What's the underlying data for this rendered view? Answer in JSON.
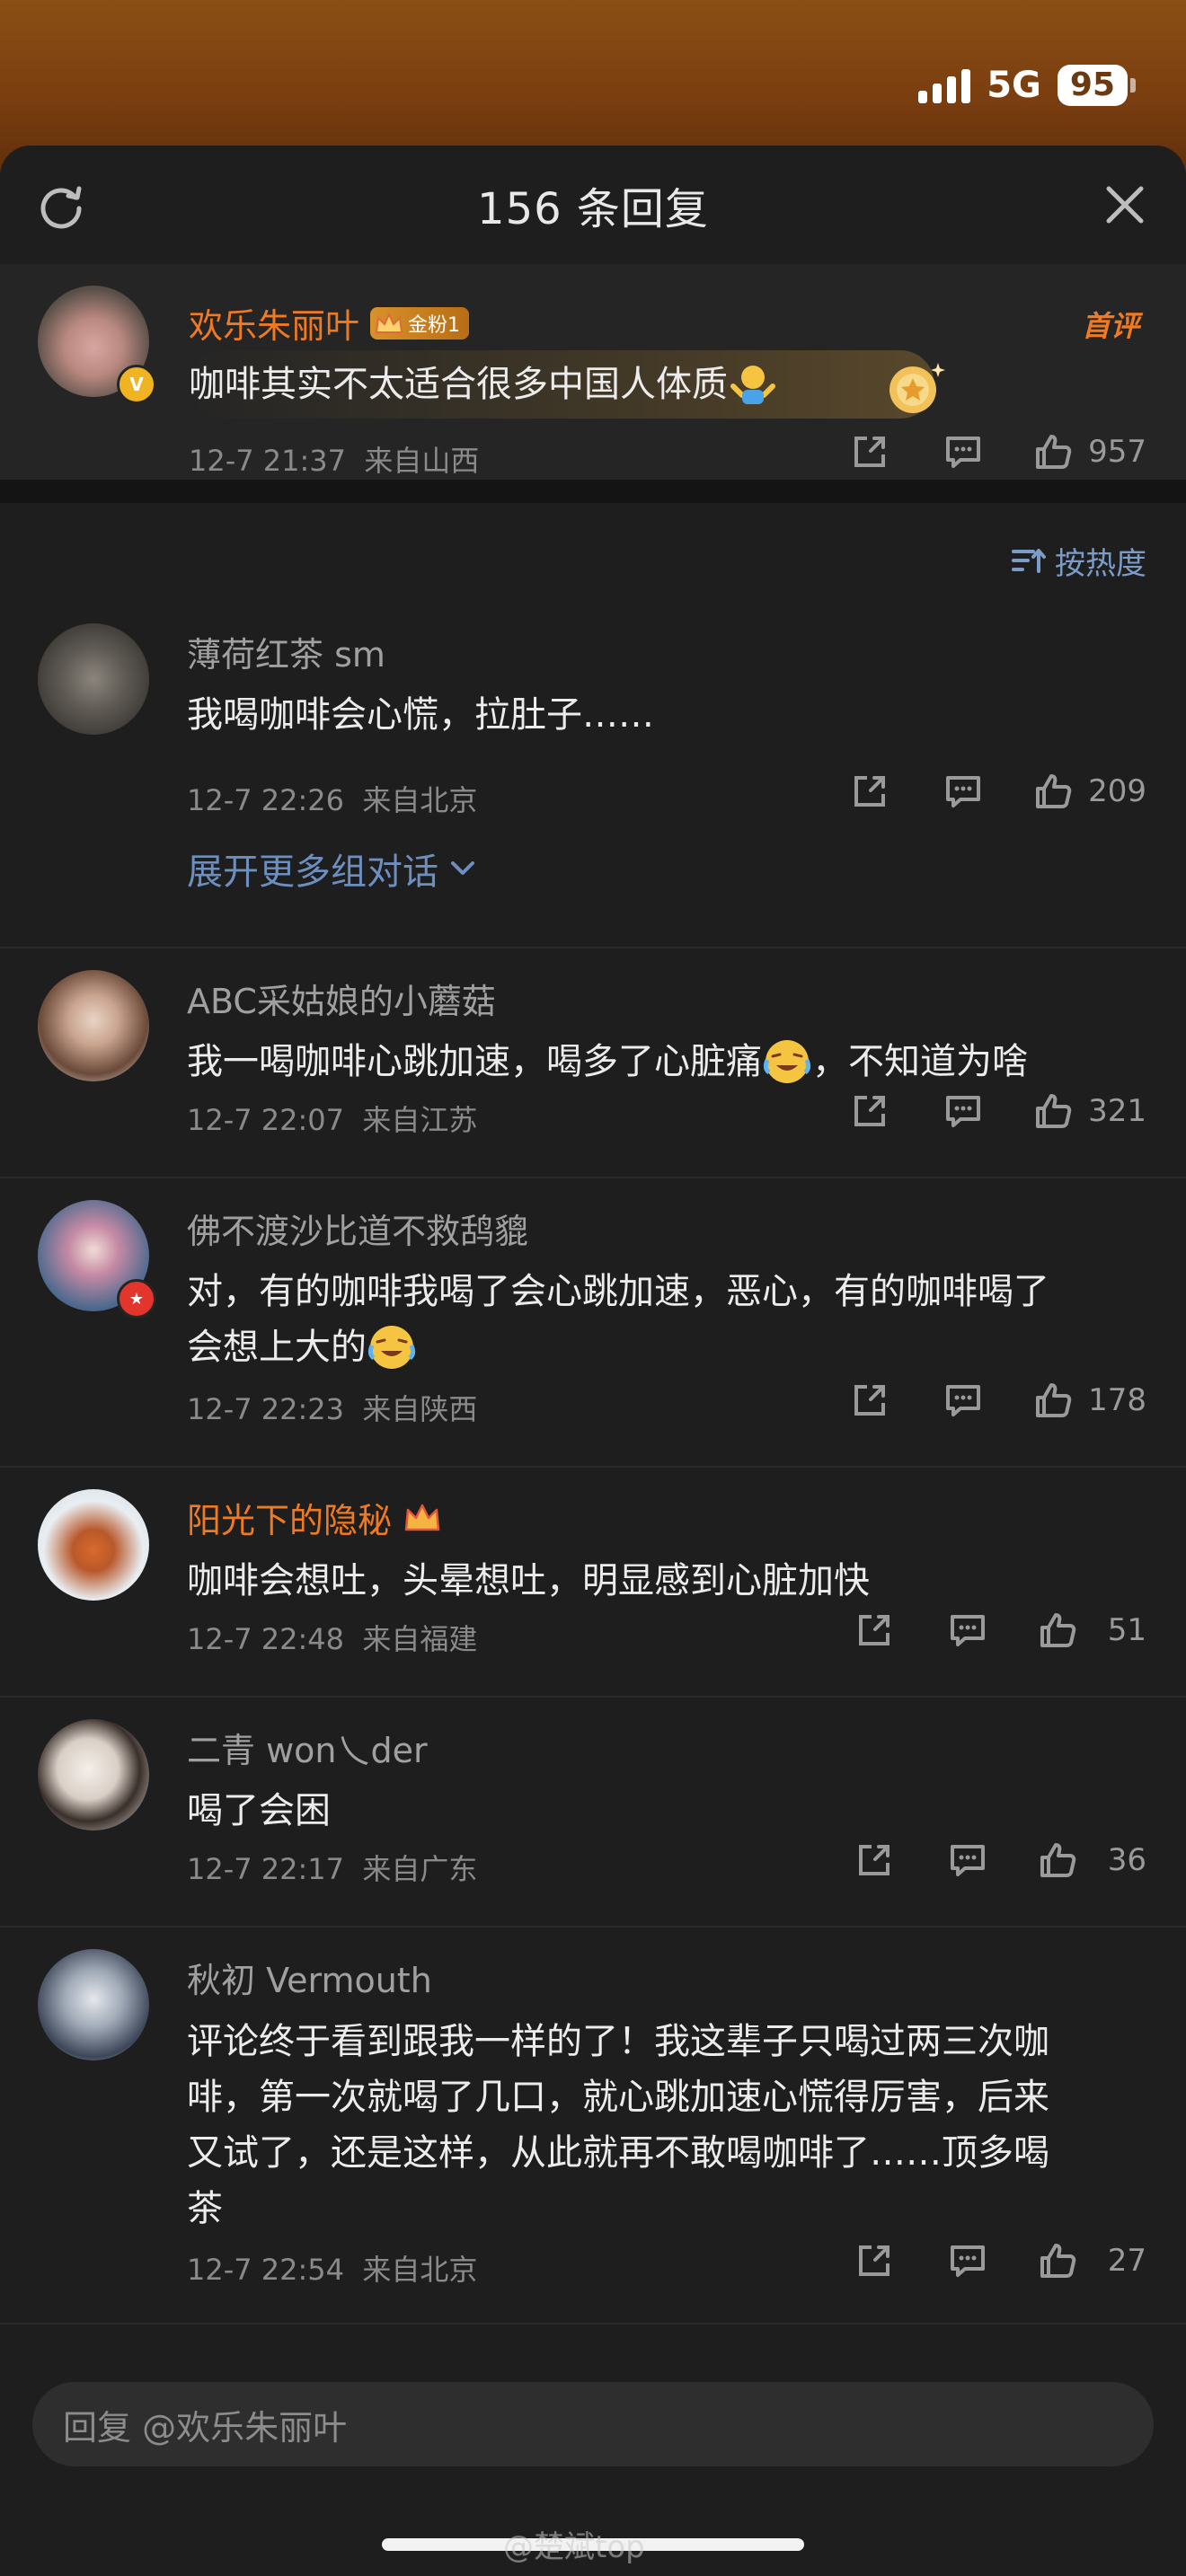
{
  "status": {
    "network": "5G",
    "battery": "95"
  },
  "sheet": {
    "title": "156 条回复"
  },
  "root_comment": {
    "name": "欢乐朱丽叶",
    "fan_badge": "金粉1",
    "first_tag": "首评",
    "text": "咖啡其实不太适合很多中国人体质",
    "time": "12-7 21:37",
    "location": "来自山西",
    "likes": "957"
  },
  "sort": {
    "label": "按热度"
  },
  "comments": [
    {
      "name": "薄荷红茶 sm",
      "text": "我喝咖啡会心慌，拉肚子……",
      "time": "12-7 22:26",
      "location": "来自北京",
      "likes": "209",
      "expand": "展开更多组对话"
    },
    {
      "name": "ABC采姑娘的小蘑菇",
      "text_a": "我一喝咖啡心跳加速，喝多了心脏痛",
      "text_b": "，不知道为啥",
      "time": "12-7 22:07",
      "location": "来自江苏",
      "likes": "321"
    },
    {
      "name": "佛不渡沙比道不救鸹貔",
      "text_line1": "对，有的咖啡我喝了会心跳加速，恶心，有的咖啡喝了",
      "text_line2": "会想上大的",
      "time": "12-7 22:23",
      "location": "来自陕西",
      "likes": "178"
    },
    {
      "name": "阳光下的隐秘",
      "text": "咖啡会想吐，头晕想吐，明显感到心脏加快",
      "time": "12-7 22:48",
      "location": "来自福建",
      "likes": "51"
    },
    {
      "name": "二青 won乀der",
      "text": "喝了会困",
      "time": "12-7 22:17",
      "location": "来自广东",
      "likes": "36"
    },
    {
      "name": "秋初 Vermouth",
      "text_line1": "评论终于看到跟我一样的了！我这辈子只喝过两三次咖",
      "text_line2": "啡，第一次就喝了几口，就心跳加速心慌得厉害，后来",
      "text_line3": "又试了，还是这样，从此就再不敢喝咖啡了……顶多喝",
      "text_line4": "茶",
      "time": "12-7 22:54",
      "location": "来自北京",
      "likes": "27"
    }
  ],
  "reply_input": {
    "placeholder": "回复 @欢乐朱丽叶"
  },
  "watermark": "@楚斌top",
  "colors": {
    "accent_orange": "#f07a22",
    "link_blue": "#6d8fc0",
    "background": "#1e1e1e"
  }
}
